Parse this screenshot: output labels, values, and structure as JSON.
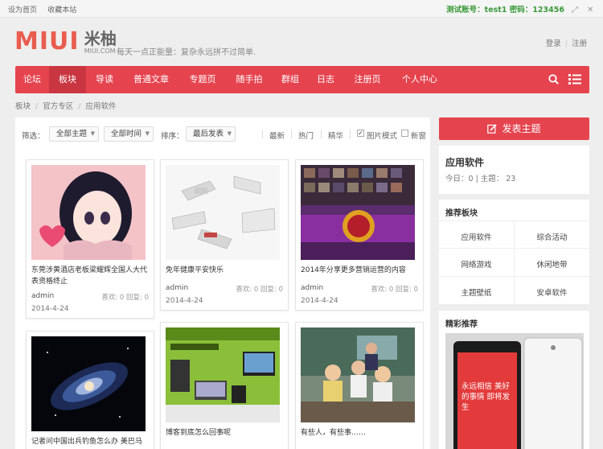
{
  "topbar": {
    "set_home": "设为首页",
    "bookmark": "收藏本站",
    "account_label": "测试账号：test1 密码：123456"
  },
  "header": {
    "logo_text": "MIUI",
    "logo_cn": "米柚",
    "logo_domain": "MIUI.COM",
    "slogan": "每天一点正能量：复杂永远拼不过简单.",
    "login": "登录",
    "register": "注册"
  },
  "nav": {
    "items": [
      {
        "label": "论坛"
      },
      {
        "label": "板块"
      },
      {
        "label": "导读"
      },
      {
        "label": "普通文章"
      },
      {
        "label": "专题页"
      },
      {
        "label": "随手拍"
      },
      {
        "label": "群组"
      },
      {
        "label": "日志"
      },
      {
        "label": "注册页"
      },
      {
        "label": "个人中心"
      }
    ],
    "active_index": 1
  },
  "breadcrumb": {
    "items": [
      "板块",
      "官方专区",
      "应用软件"
    ]
  },
  "filter": {
    "label_filter": "筛选：",
    "all_topics": "全部主题",
    "all_time": "全部时间",
    "label_sort": "排序：",
    "sort_by": "最后发表",
    "newest": "最新",
    "hot": "热门",
    "digest": "精华",
    "pic_mode": "图片模式",
    "new_window": "新窗",
    "pic_mode_checked": true,
    "new_window_checked": false
  },
  "posts": [
    {
      "title": "东莞涉黄酒店老板梁耀辉全国人大代表资格终止",
      "author": "admin",
      "likes": "喜欢: 0",
      "replies": "回复: 0",
      "date": "2014-4-24"
    },
    {
      "title": "免年健康平安快乐",
      "author": "admin",
      "likes": "喜欢: 0",
      "replies": "回复: 0",
      "date": "2014-4-24"
    },
    {
      "title": "2014年分享更多营销运营的内容",
      "author": "admin",
      "likes": "喜欢: 0",
      "replies": "回复: 0",
      "date": "2014-4-24"
    },
    {
      "title": "记者问中国出兵钓鱼怎么办 美巴马",
      "author": "",
      "likes": "",
      "replies": "",
      "date": ""
    },
    {
      "title": "博客到底怎么回事呢",
      "author": "",
      "likes": "",
      "replies": "",
      "date": ""
    },
    {
      "title": "有些人，有些事……",
      "author": "",
      "likes": "",
      "replies": "",
      "date": ""
    }
  ],
  "sidebar": {
    "post_button": "发表主题",
    "forum_name": "应用软件",
    "forum_stats": "今日：0 | 主题： 23",
    "recommended_title": "推荐板块",
    "recommended": [
      "应用软件",
      "综合活动",
      "网络游戏",
      "休闲地带",
      "主题壁纸",
      "安卓软件"
    ],
    "featured_title": "精彩推荐",
    "featured_caption": "永远相信 美好的事情 即将发生"
  },
  "colors": {
    "brand_red": "#e5444f",
    "nav_active": "#c93540",
    "account_green": "#3a9a3a"
  }
}
